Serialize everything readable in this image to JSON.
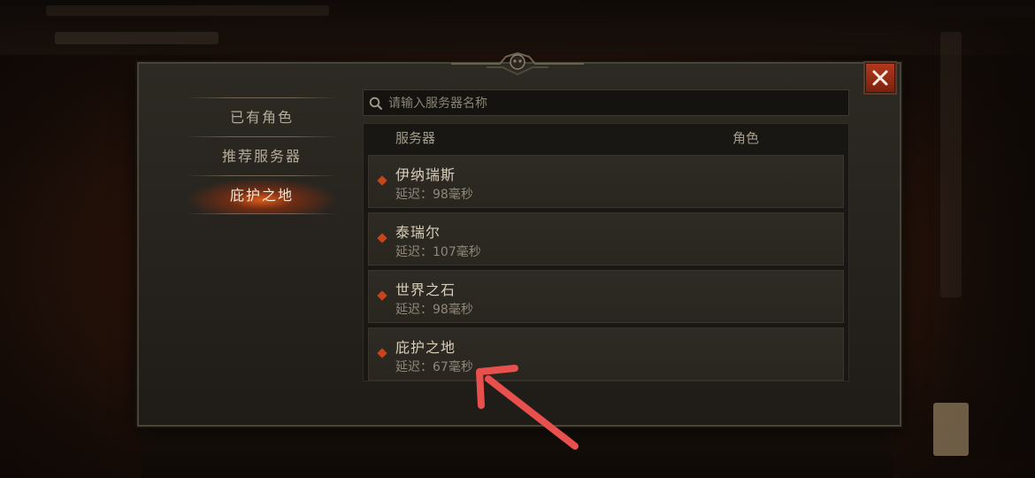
{
  "sidebar": {
    "items": [
      {
        "label": "已有角色",
        "active": false
      },
      {
        "label": "推荐服务器",
        "active": false
      },
      {
        "label": "庇护之地",
        "active": true
      }
    ]
  },
  "search": {
    "placeholder": "请输入服务器名称",
    "value": ""
  },
  "table": {
    "col_server": "服务器",
    "col_character": "角色"
  },
  "servers": [
    {
      "name": "伊纳瑞斯",
      "latency_label": "延迟：",
      "latency": "98毫秒"
    },
    {
      "name": "泰瑞尔",
      "latency_label": "延迟：",
      "latency": "107毫秒"
    },
    {
      "name": "世界之石",
      "latency_label": "延迟：",
      "latency": "98毫秒"
    },
    {
      "name": "庇护之地",
      "latency_label": "延迟：",
      "latency": "67毫秒"
    }
  ],
  "icons": {
    "close": "close-icon",
    "search": "search-icon",
    "row_marker": "diamond-icon"
  },
  "colors": {
    "accent": "#c8451c",
    "close_bg": "#9a2c14",
    "active_glow": "#e65f19",
    "annotation": "#e8504e"
  }
}
